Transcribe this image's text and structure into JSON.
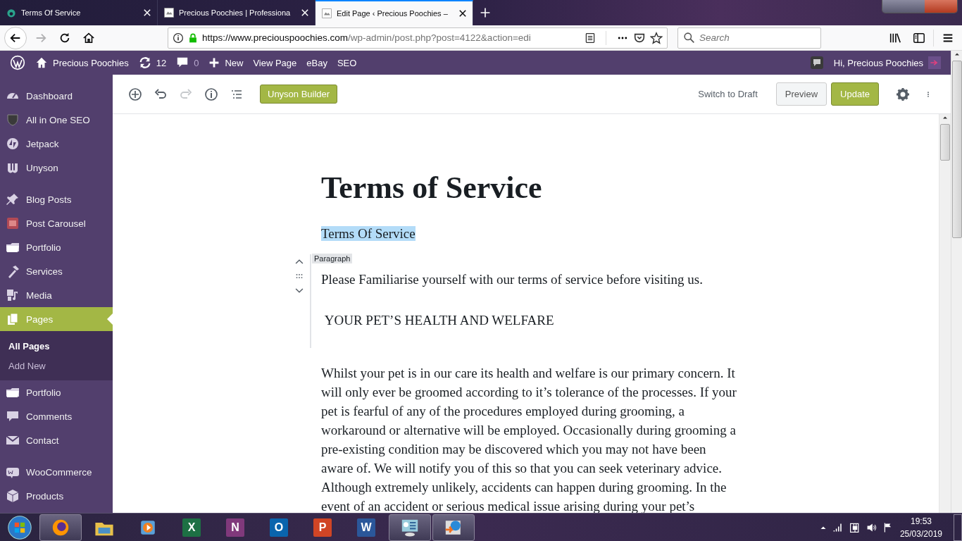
{
  "browser": {
    "tabs": [
      {
        "title": "Terms Of Service",
        "kind": "paw",
        "selected": false
      },
      {
        "title": "Precious Poochies | Professiona",
        "kind": "site",
        "selected": false
      },
      {
        "title": "Edit Page ‹ Precious Poochies –",
        "kind": "site",
        "selected": true
      }
    ],
    "back": {
      "disabled": false
    },
    "forward": {
      "disabled": true
    },
    "url": {
      "host": "https://www.preciouspoochies.com",
      "path": "/wp-admin/post.php?post=4122&action=edi"
    },
    "search": {
      "placeholder": "Search"
    }
  },
  "admin_bar": {
    "site": "Precious Poochies",
    "updates": "12",
    "comments": "0",
    "new": "New",
    "links": [
      "View Page",
      "eBay",
      "SEO"
    ],
    "greeting": "Hi, Precious Poochies"
  },
  "sidebar": {
    "groups": [
      [
        {
          "label": "Dashboard",
          "kind": "dashboard",
          "selected": false
        },
        {
          "label": "All in One SEO",
          "kind": "shield",
          "selected": false
        },
        {
          "label": "Jetpack",
          "kind": "jetpack",
          "selected": false
        },
        {
          "label": "Unyson",
          "kind": "unyson",
          "selected": false
        }
      ],
      [
        {
          "label": "Blog Posts",
          "kind": "pin",
          "selected": false
        },
        {
          "label": "Post Carousel",
          "kind": "carousel",
          "selected": false
        },
        {
          "label": "Portfolio",
          "kind": "folder",
          "selected": false
        },
        {
          "label": "Services",
          "kind": "hammer",
          "selected": false
        },
        {
          "label": "Media",
          "kind": "media",
          "selected": false
        },
        {
          "label": "Pages",
          "kind": "pages",
          "selected": true,
          "children": [
            {
              "label": "All Pages",
              "selected": true
            },
            {
              "label": "Add New",
              "selected": false
            }
          ]
        },
        {
          "label": "Portfolio",
          "kind": "folder",
          "selected": false
        },
        {
          "label": "Comments",
          "kind": "comment",
          "selected": false
        },
        {
          "label": "Contact",
          "kind": "mail",
          "selected": false
        }
      ],
      [
        {
          "label": "WooCommerce",
          "kind": "woo",
          "selected": false
        },
        {
          "label": "Products",
          "kind": "box",
          "selected": false
        }
      ]
    ]
  },
  "editor": {
    "toolbar": {
      "undo_disabled": false,
      "redo_disabled": true,
      "builder": "Unyson Builder",
      "switch": "Switch to Draft",
      "preview": "Preview",
      "update": "Update"
    },
    "title": "Terms of Service",
    "blocks": [
      {
        "lines": [
          "Terms Of Service"
        ],
        "highlighted": true,
        "selected": false
      },
      {
        "label": "Paragraph",
        "lines": [
          "Please Familiarise yourself with our terms of service before visiting us.",
          " YOUR PET’S HEALTH AND WELFARE"
        ],
        "highlighted": false,
        "selected": true
      },
      {
        "lines": [
          "Whilst your pet is in our care its health and welfare is our primary concern. It will only ever be groomed according to it’s tolerance of the processes. If your pet is fearful of any of the procedures employed during grooming, a workaround or alternative will be employed. Occasionally during grooming a pre-existing condition may be discovered which you may not have been aware of. We will notify you of this so that you can seek veterinary advice. Although extremely unlikely, accidents can happen during grooming. In the event of an accident or serious medical issue arising during your pet’s"
        ],
        "highlighted": false,
        "selected": false
      }
    ]
  },
  "taskbar": {
    "apps": [
      {
        "kind": "firefox",
        "running": true
      },
      {
        "kind": "explorer",
        "running": false
      },
      {
        "kind": "media",
        "running": false
      },
      {
        "kind": "office",
        "letter": "X",
        "color": "#1d7044",
        "running": false
      },
      {
        "kind": "office",
        "letter": "N",
        "color": "#80397b",
        "running": false
      },
      {
        "kind": "office",
        "letter": "O",
        "color": "#0a64ad",
        "running": false
      },
      {
        "kind": "office",
        "letter": "P",
        "color": "#d04525",
        "running": false
      },
      {
        "kind": "office",
        "letter": "W",
        "color": "#2b579a",
        "running": false
      },
      {
        "kind": "panel",
        "running": true
      },
      {
        "kind": "globe",
        "running": true
      }
    ],
    "time": "19:53",
    "date": "25/03/2019"
  }
}
